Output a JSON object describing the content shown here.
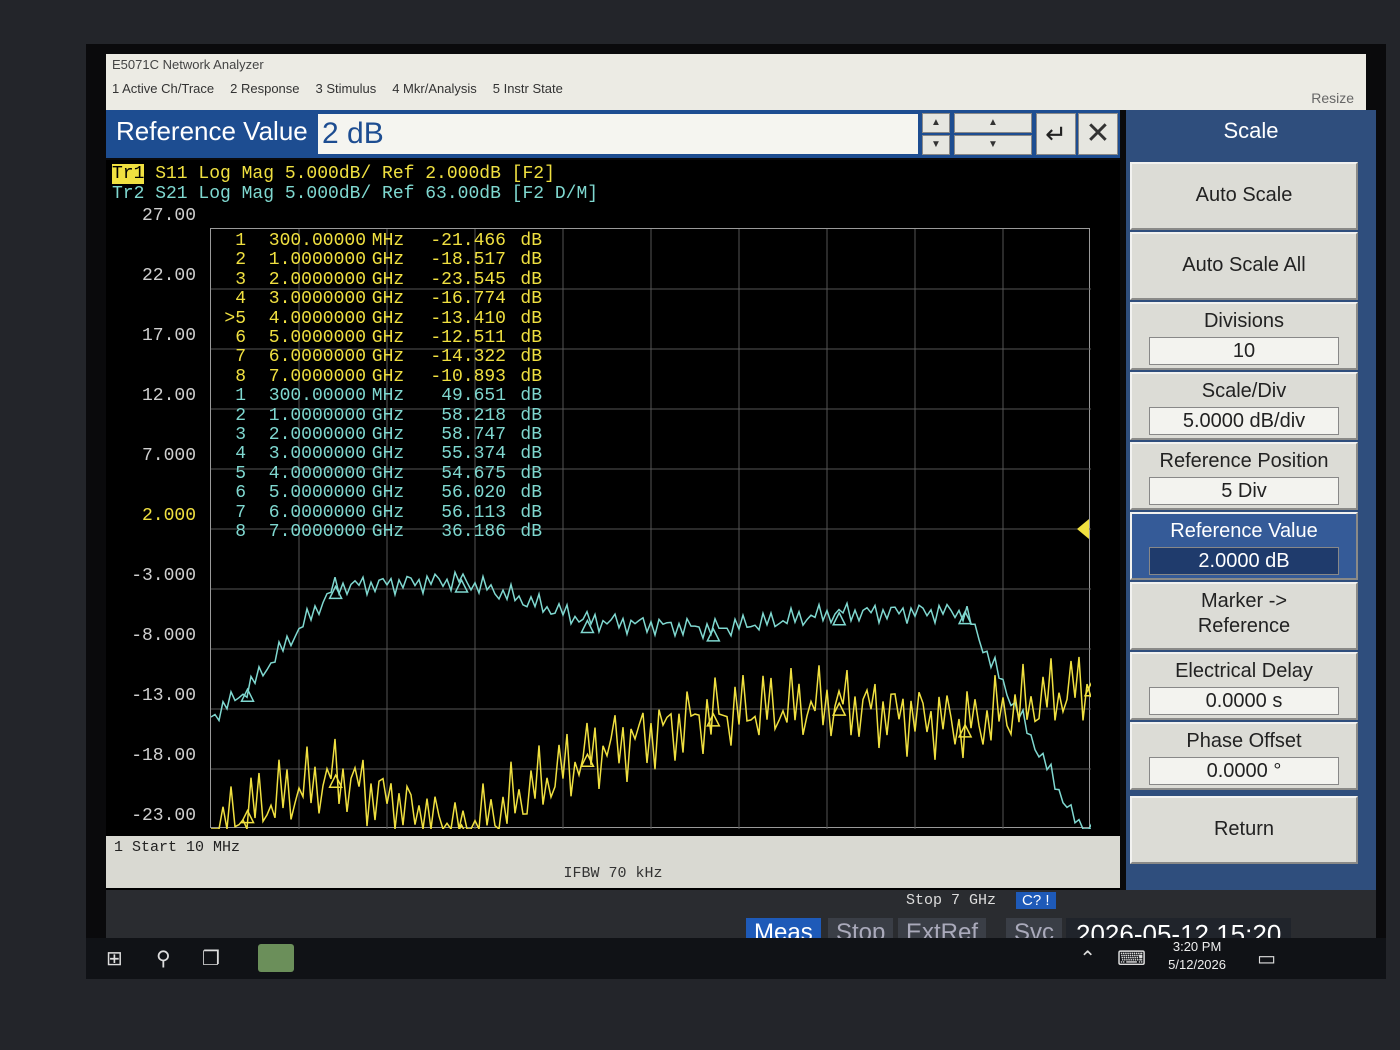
{
  "app": {
    "title": "E5071C Network Analyzer",
    "menu": [
      "1 Active Ch/Trace",
      "2 Response",
      "3 Stimulus",
      "4 Mkr/Analysis",
      "5 Instr State"
    ],
    "resize_label": "Resize"
  },
  "entry": {
    "label": "Reference Value",
    "value": "2 dB",
    "up_glyph": "▲",
    "down_glyph": "▼",
    "enter_glyph": "↵",
    "close_glyph": "✕"
  },
  "traces": {
    "tr1": {
      "tag": "Tr1",
      "rest": " S11 Log Mag 5.000dB/ Ref 2.000dB [F2]",
      "color": "#f0e040"
    },
    "tr2": {
      "tag": "Tr2",
      "rest": " S21 Log Mag 5.000dB/ Ref 63.00dB [F2 D/M]",
      "color": "#7fd8d0"
    }
  },
  "y_ticks": [
    "27.00",
    "22.00",
    "17.00",
    "12.00",
    "7.000",
    "2.000",
    "-3.000",
    "-8.000",
    "-13.00",
    "-18.00",
    "-23.00"
  ],
  "reference_tick": "2.000",
  "markers_tr1": [
    {
      "id": "1",
      "freq": "300.00000",
      "unit": "MHz",
      "value": "-21.466",
      "db": "dB"
    },
    {
      "id": "2",
      "freq": "1.0000000",
      "unit": "GHz",
      "value": "-18.517",
      "db": "dB"
    },
    {
      "id": "3",
      "freq": "2.0000000",
      "unit": "GHz",
      "value": "-23.545",
      "db": "dB"
    },
    {
      "id": "4",
      "freq": "3.0000000",
      "unit": "GHz",
      "value": "-16.774",
      "db": "dB"
    },
    {
      "id": ">5",
      "freq": "4.0000000",
      "unit": "GHz",
      "value": "-13.410",
      "db": "dB"
    },
    {
      "id": "6",
      "freq": "5.0000000",
      "unit": "GHz",
      "value": "-12.511",
      "db": "dB"
    },
    {
      "id": "7",
      "freq": "6.0000000",
      "unit": "GHz",
      "value": "-14.322",
      "db": "dB"
    },
    {
      "id": "8",
      "freq": "7.0000000",
      "unit": "GHz",
      "value": "-10.893",
      "db": "dB"
    }
  ],
  "markers_tr2": [
    {
      "id": "1",
      "freq": "300.00000",
      "unit": "MHz",
      "value": "49.651",
      "db": "dB"
    },
    {
      "id": "2",
      "freq": "1.0000000",
      "unit": "GHz",
      "value": "58.218",
      "db": "dB"
    },
    {
      "id": "3",
      "freq": "2.0000000",
      "unit": "GHz",
      "value": "58.747",
      "db": "dB"
    },
    {
      "id": "4",
      "freq": "3.0000000",
      "unit": "GHz",
      "value": "55.374",
      "db": "dB"
    },
    {
      "id": "5",
      "freq": "4.0000000",
      "unit": "GHz",
      "value": "54.675",
      "db": "dB"
    },
    {
      "id": "6",
      "freq": "5.0000000",
      "unit": "GHz",
      "value": "56.020",
      "db": "dB"
    },
    {
      "id": "7",
      "freq": "6.0000000",
      "unit": "GHz",
      "value": "56.113",
      "db": "dB"
    },
    {
      "id": "8",
      "freq": "7.0000000",
      "unit": "GHz",
      "value": "36.186",
      "db": "dB"
    }
  ],
  "sweep": {
    "start_label": "1  Start 10 MHz",
    "ifbw_label": "IFBW 70 kHz",
    "stop_label": "Stop 7 GHz",
    "x_start_ghz": 0.01,
    "x_stop_ghz": 7.0,
    "tr1_ylim": [
      -23,
      27
    ],
    "tr2_ylim": [
      38,
      88
    ]
  },
  "softkeys": {
    "title": "Scale",
    "auto_scale": "Auto Scale",
    "auto_scale_all": "Auto Scale All",
    "divisions_label": "Divisions",
    "divisions_value": "10",
    "scale_div_label": "Scale/Div",
    "scale_div_value": "5.0000 dB/div",
    "ref_pos_label": "Reference Position",
    "ref_pos_value": "5 Div",
    "ref_val_label": "Reference Value",
    "ref_val_value": "2.0000 dB",
    "marker_ref_1": "Marker ->",
    "marker_ref_2": "Reference",
    "edelay_label": "Electrical Delay",
    "edelay_value": "0.0000 s",
    "phase_label": "Phase Offset",
    "phase_value": "0.0000 °",
    "return": "Return"
  },
  "status": {
    "cq": "C?",
    "warn": "!",
    "meas": "Meas",
    "stop": "Stop",
    "extref": "ExtRef",
    "svc": "Svc",
    "datetime": "2026-05-12 15:20"
  },
  "taskbar": {
    "time": "3:20 PM",
    "date": "5/12/2026"
  },
  "chart_data": {
    "type": "line",
    "series": [
      {
        "name": "Tr1 S11",
        "x_ghz": [
          0.3,
          1.0,
          2.0,
          3.0,
          4.0,
          5.0,
          6.0,
          7.0
        ],
        "y_db": [
          -21.466,
          -18.517,
          -23.545,
          -16.774,
          -13.41,
          -12.511,
          -14.322,
          -10.893
        ]
      },
      {
        "name": "Tr2 S21",
        "x_ghz": [
          0.3,
          1.0,
          2.0,
          3.0,
          4.0,
          5.0,
          6.0,
          7.0
        ],
        "y_db": [
          49.651,
          58.218,
          58.747,
          55.374,
          54.675,
          56.02,
          56.113,
          36.186
        ]
      }
    ],
    "xlim": [
      0.01,
      7.0
    ],
    "ylim_tr1": [
      -23,
      27
    ],
    "ylim_tr2": [
      38,
      88
    ],
    "grid": true
  }
}
